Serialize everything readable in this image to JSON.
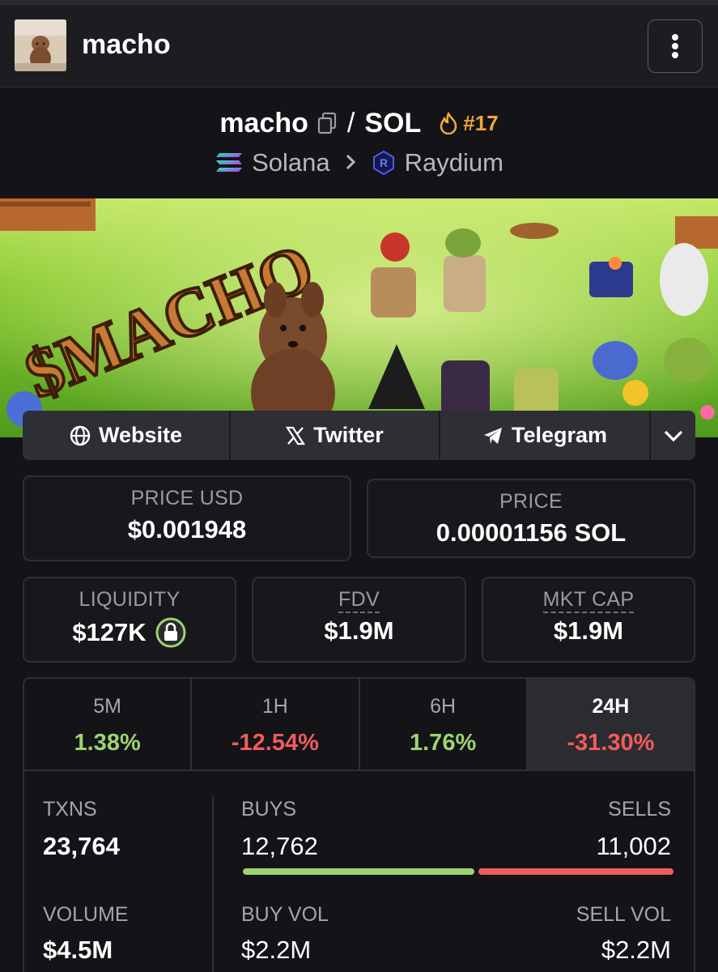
{
  "header": {
    "title": "macho"
  },
  "pair": {
    "base": "macho",
    "separator": "/",
    "quote": "SOL",
    "rank": "#17",
    "chain": "Solana",
    "dex": "Raydium"
  },
  "banner": {
    "text": "$MACHO"
  },
  "links": {
    "website": "Website",
    "twitter": "Twitter",
    "telegram": "Telegram"
  },
  "stats": {
    "price_usd_label": "PRICE USD",
    "price_usd": "$0.001948",
    "price_label": "PRICE",
    "price": "0.00001156 SOL",
    "liquidity_label": "LIQUIDITY",
    "liquidity": "$127K",
    "fdv_label": "FDV",
    "fdv": "$1.9M",
    "mktcap_label": "MKT CAP",
    "mktcap": "$1.9M"
  },
  "timeframes": [
    {
      "label": "5M",
      "value": "1.38%",
      "trend": "up"
    },
    {
      "label": "1H",
      "value": "-12.54%",
      "trend": "down"
    },
    {
      "label": "6H",
      "value": "1.76%",
      "trend": "up"
    },
    {
      "label": "24H",
      "value": "-31.30%",
      "trend": "down",
      "active": true
    }
  ],
  "activity": {
    "txns_label": "TXNS",
    "txns": "23,764",
    "buys_label": "BUYS",
    "buys": "12,762",
    "sells_label": "SELLS",
    "sells": "11,002",
    "volume_label": "VOLUME",
    "volume": "$4.5M",
    "buy_vol_label": "BUY VOL",
    "buy_vol": "$2.2M",
    "sell_vol_label": "SELL VOL",
    "sell_vol": "$2.2M",
    "buy_ratio": 0.537
  },
  "colors": {
    "positive": "#9ed36e",
    "negative": "#f05c5c",
    "rank": "#f2a735"
  }
}
